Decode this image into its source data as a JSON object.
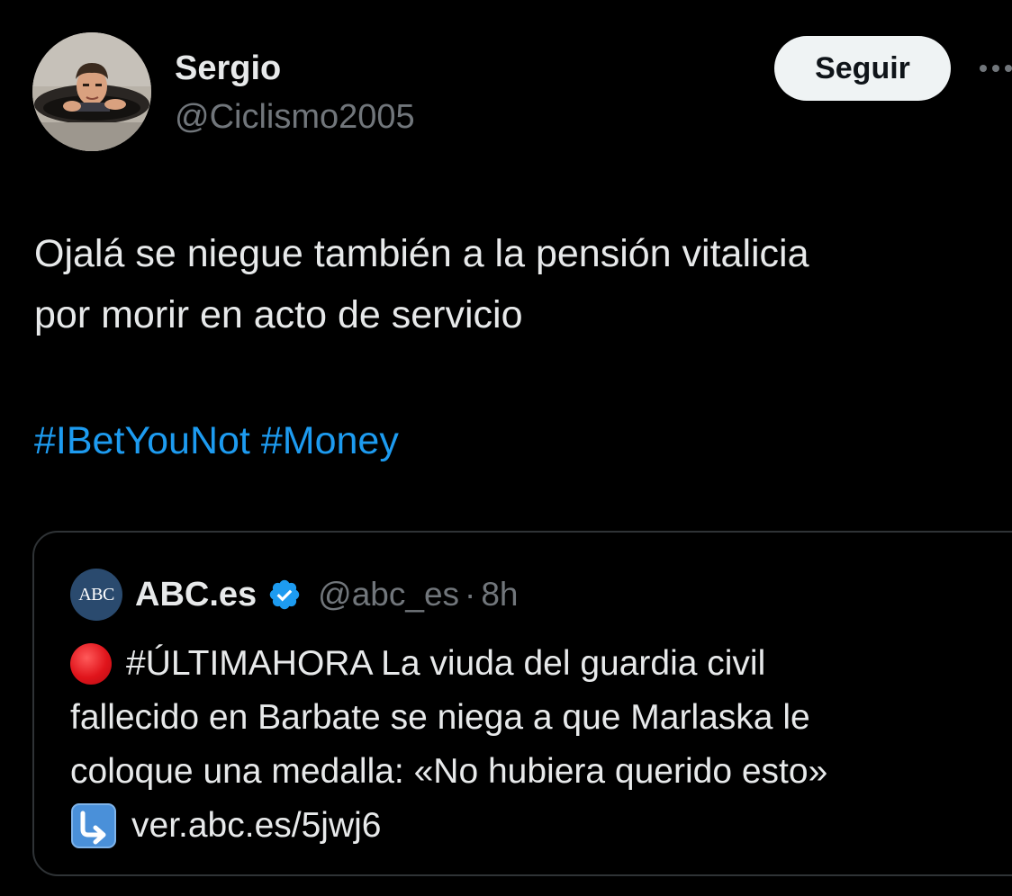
{
  "tweet": {
    "author": {
      "name": "Sergio",
      "handle": "@Ciclismo2005"
    },
    "follow_label": "Seguir",
    "more_icon": "more-horizontal-icon",
    "text_lines": [
      "Ojalá se niegue también a la pensión vitalicia",
      "por morir en acto de servicio"
    ],
    "hashtags": [
      "#IBetYouNot",
      "#Money"
    ]
  },
  "quote": {
    "avatar_text": "ABC",
    "name": "ABC.es",
    "verified_icon": "verified-badge-icon",
    "handle": "@abc_es",
    "separator": "·",
    "time": "8h",
    "lines": [
      "#ÚLTIMAHORA La viuda del guardia civil",
      "fallecido en Barbate se niega a que Marlaska le",
      "coloque una medalla: «No hubiera querido esto»",
      "ver.abc.es/5jwj6"
    ],
    "red_circle_icon": "red-circle-icon",
    "arrow_icon": "arrow-down-right-icon"
  },
  "colors": {
    "background": "#000000",
    "text": "#e7e9ea",
    "muted": "#71767b",
    "link": "#1d9bf0",
    "border": "#2f3336",
    "button_bg": "#eff3f4",
    "verified": "#1d9bf0"
  }
}
